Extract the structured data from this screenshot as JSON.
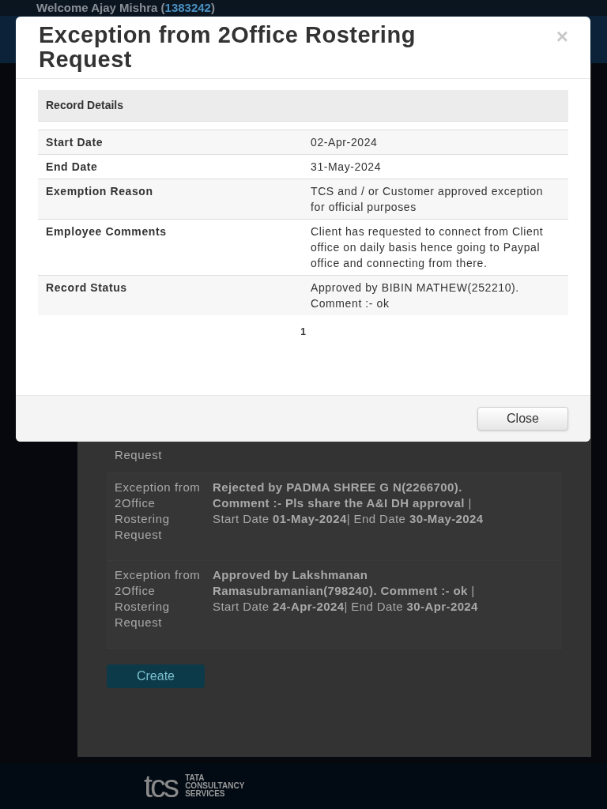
{
  "header": {
    "welcome": "Welcome Ajay Mishra (",
    "employee_id": "1383242",
    "welcome_end": ")"
  },
  "requests": [
    {
      "type": "Request"
    },
    {
      "type": "Exception from 2Office Rostering Request",
      "status": "**Rejected by PADMA SHREE G N(2266700). Comment :- Pls share the A&I DH approval** | Start Date **01-May-2024**| End Date **30-May-2024**"
    },
    {
      "type": "Exception from 2Office Rostering Request",
      "status": "**Approved by Lakshmanan Ramasubramanian(798240). Comment :- ok** | Start Date **24-Apr-2024**| End Date **30-Apr-2024**"
    }
  ],
  "create_button": "Create",
  "footer": {
    "logo": "tcs",
    "company": [
      "TATA",
      "CONSULTANCY",
      "SERVICES"
    ]
  },
  "modal": {
    "title": "Exception from 2Office Rostering Request",
    "close_icon": "×",
    "section": "Record Details",
    "rows": [
      {
        "label": "Start Date",
        "value": "02-Apr-2024"
      },
      {
        "label": "End Date",
        "value": "31-May-2024"
      },
      {
        "label": "Exemption Reason",
        "value": "TCS and / or Customer approved exception for official purposes"
      },
      {
        "label": "Employee Comments",
        "value": "Client has requested to connect from Client office on daily basis hence going to Paypal office and connecting from there."
      },
      {
        "label": "Record Status",
        "value": "Approved by BIBIN MATHEW(252210). Comment :- ok"
      }
    ],
    "page": "1",
    "close_button": "Close"
  }
}
